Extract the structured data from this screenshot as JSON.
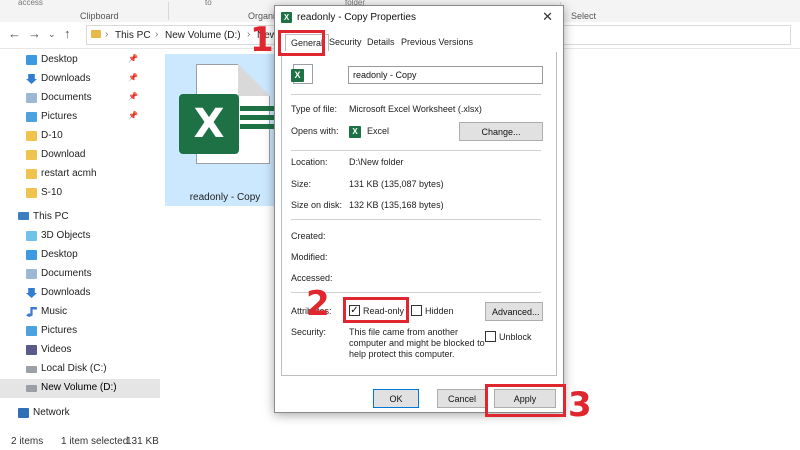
{
  "ribbon": {
    "clipboard_label": "Clipboard",
    "organize_label": "Organi",
    "select_label": "Select",
    "access_label": "access",
    "to_label": "to",
    "folder_label": "folder"
  },
  "address": {
    "crumbs": [
      "This PC",
      "New Volume (D:)",
      "New fo"
    ]
  },
  "sidebar": {
    "quick_access": [
      {
        "label": "Desktop",
        "icon": "desktop-icon",
        "pinned": true
      },
      {
        "label": "Downloads",
        "icon": "downloads-icon",
        "pinned": true
      },
      {
        "label": "Documents",
        "icon": "documents-icon",
        "pinned": true
      },
      {
        "label": "Pictures",
        "icon": "pictures-icon",
        "pinned": true
      },
      {
        "label": "D-10",
        "icon": "folder-icon",
        "pinned": false
      },
      {
        "label": "Download",
        "icon": "folder-icon",
        "pinned": false
      },
      {
        "label": "restart acmh",
        "icon": "folder-icon",
        "pinned": false
      },
      {
        "label": "S-10",
        "icon": "folder-icon",
        "pinned": false
      }
    ],
    "this_pc": {
      "label": "This PC",
      "icon": "pc-icon"
    },
    "pc_items": [
      {
        "label": "3D Objects",
        "icon": "3d-objects-icon"
      },
      {
        "label": "Desktop",
        "icon": "desktop-icon"
      },
      {
        "label": "Documents",
        "icon": "documents-icon"
      },
      {
        "label": "Downloads",
        "icon": "downloads-icon"
      },
      {
        "label": "Music",
        "icon": "music-icon"
      },
      {
        "label": "Pictures",
        "icon": "pictures-icon"
      },
      {
        "label": "Videos",
        "icon": "videos-icon"
      },
      {
        "label": "Local Disk (C:)",
        "icon": "disk-icon"
      },
      {
        "label": "New Volume (D:)",
        "icon": "disk-icon",
        "selected": true
      }
    ],
    "network": {
      "label": "Network",
      "icon": "network-icon"
    }
  },
  "file_tile": {
    "name": "readonly - Copy",
    "icon_letter": "X"
  },
  "status": {
    "items_count": "2 items",
    "selection": "1 item selected",
    "size": "131 KB"
  },
  "dialog": {
    "title": "readonly - Copy Properties",
    "close_glyph": "✕",
    "title_icon_letter": "X",
    "tabs": [
      "General",
      "Security",
      "Details",
      "Previous Versions"
    ],
    "active_tab": "General",
    "file_name_value": "readonly - Copy",
    "fields": {
      "type_label": "Type of file:",
      "type_value": "Microsoft Excel Worksheet (.xlsx)",
      "opens_label": "Opens with:",
      "opens_value": "Excel",
      "change_label": "Change...",
      "location_label": "Location:",
      "location_value": "D:\\New folder",
      "size_label": "Size:",
      "size_value": "131 KB (135,087 bytes)",
      "size_disk_label": "Size on disk:",
      "size_disk_value": "132 KB (135,168 bytes)",
      "created_label": "Created:",
      "modified_label": "Modified:",
      "accessed_label": "Accessed:",
      "attributes_label": "Attributes:",
      "readonly_label": "Read-only",
      "readonly_checked": true,
      "hidden_label": "Hidden",
      "advanced_label": "Advanced...",
      "security_label": "Security:",
      "security_text_1": "This file came from another",
      "security_text_2": "computer and might be blocked to",
      "security_text_3": "help protect this computer.",
      "unblock_label": "Unblock"
    },
    "buttons": {
      "ok": "OK",
      "cancel": "Cancel",
      "apply": "Apply"
    }
  },
  "annotations": {
    "step1": "1",
    "step2": "2",
    "step3": "3",
    "color": "#e0262e"
  },
  "colors": {
    "excel_green": "#1e7145",
    "selection_blue": "#cce8ff",
    "accent_blue": "#0078d7"
  }
}
